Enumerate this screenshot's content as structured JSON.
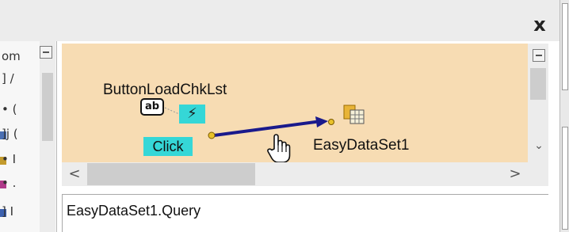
{
  "window": {
    "close_glyph": "x"
  },
  "left_pane": {
    "items": [
      {
        "text": "om",
        "icon": "",
        "color": ""
      },
      {
        "text": "] /",
        "icon": "",
        "color": ""
      },
      {
        "text": "• (",
        "icon": "",
        "color": ""
      },
      {
        "text": "]j (",
        "icon": "component-icon",
        "color": "#4a6fb3"
      },
      {
        "text": "• I",
        "icon": "component-icon",
        "color": "#c39b2d"
      },
      {
        "text": "• .",
        "icon": "component-icon",
        "color": "#b03a8a"
      },
      {
        "text": "] I",
        "icon": "component-icon",
        "color": "#3d62b0"
      }
    ]
  },
  "diagram": {
    "source_component": {
      "label": "ButtonLoadChkLst",
      "icon_text": "ab",
      "event_icon_glyph": "⚡",
      "event": "Click"
    },
    "target_component": {
      "label": "EasyDataSet1",
      "icon": "dataset-icon"
    },
    "link": {
      "color": "#1a1a8c"
    },
    "background_color": "#f7dcb3",
    "accent_color": "#35d7d7"
  },
  "scrollbars": {
    "left_arrow": "<",
    "right_arrow": ">",
    "down_arrow": "⌄"
  },
  "bottom_panel": {
    "text": "EasyDataSet1.Query"
  }
}
